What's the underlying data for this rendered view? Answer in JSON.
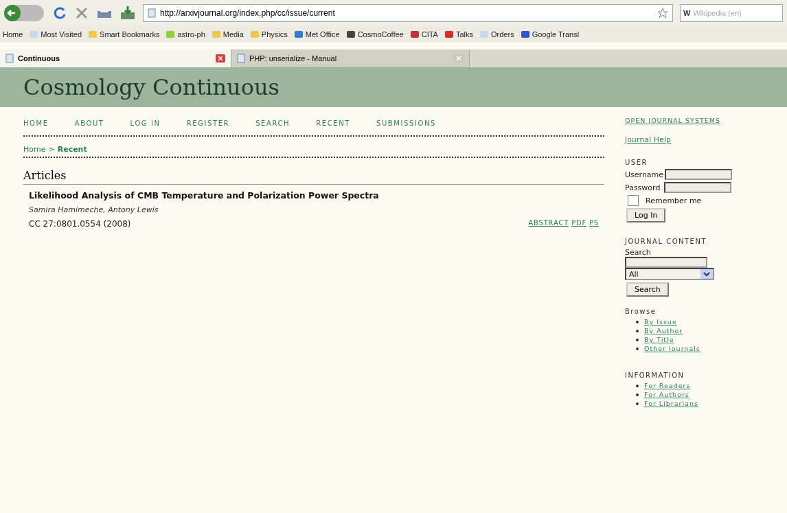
{
  "browser": {
    "url": "http://arxivjournal.org/index.php/cc/issue/current",
    "search_engine_logo": "W",
    "search_engine": "Wikipedia (en)",
    "bookmarks": [
      {
        "label": "Home",
        "kind": "plain"
      },
      {
        "label": "Most Visited",
        "kind": "page"
      },
      {
        "label": "Smart Bookmarks",
        "kind": "folder"
      },
      {
        "label": "astro-ph",
        "kind": "smiley"
      },
      {
        "label": "Media",
        "kind": "folder"
      },
      {
        "label": "Physics",
        "kind": "folder"
      },
      {
        "label": "Met Office",
        "kind": "wave"
      },
      {
        "label": "CosmoCoffee",
        "kind": "coffee"
      },
      {
        "label": "CITA",
        "kind": "feather"
      },
      {
        "label": "Talks",
        "kind": "shield"
      },
      {
        "label": "Orders",
        "kind": "page"
      },
      {
        "label": "Google Transl",
        "kind": "google"
      }
    ],
    "tabs": [
      {
        "label": "Continuous",
        "selected": true
      },
      {
        "label": "PHP: unserialize - Manual",
        "selected": false
      }
    ]
  },
  "site": {
    "title": "Cosmology Continuous",
    "nav": [
      "HOME",
      "ABOUT",
      "LOG IN",
      "REGISTER",
      "SEARCH",
      "RECENT",
      "SUBMISSIONS"
    ],
    "breadcrumb": {
      "home": "Home",
      "separator": ">",
      "current": "Recent"
    },
    "section": "Articles",
    "articles": [
      {
        "title": "Likelihood Analysis of CMB Temperature and Polarization Power Spectra",
        "authors": "Samira Hamimeche, Antony Lewis",
        "citation": "CC 27:0801.0554 (2008)",
        "links": [
          "ABSTRACT",
          "PDF",
          "PS"
        ]
      }
    ]
  },
  "sidebar": {
    "ojs": "OPEN JOURNAL SYSTEMS",
    "help": "Journal Help",
    "user_heading": "USER",
    "username_label": "Username",
    "password_label": "Password",
    "remember": {
      "label": "Remember me",
      "checked": false
    },
    "login_button": "Log In",
    "content_heading": "JOURNAL CONTENT",
    "search_label": "Search",
    "scope": "All",
    "search_button": "Search",
    "browse_heading": "Browse",
    "browse_links": [
      "By Issue",
      "By Author",
      "By Title",
      "Other Journals"
    ],
    "info_heading": "INFORMATION",
    "info_links": [
      "For Readers",
      "For Authors",
      "For Librarians"
    ]
  }
}
